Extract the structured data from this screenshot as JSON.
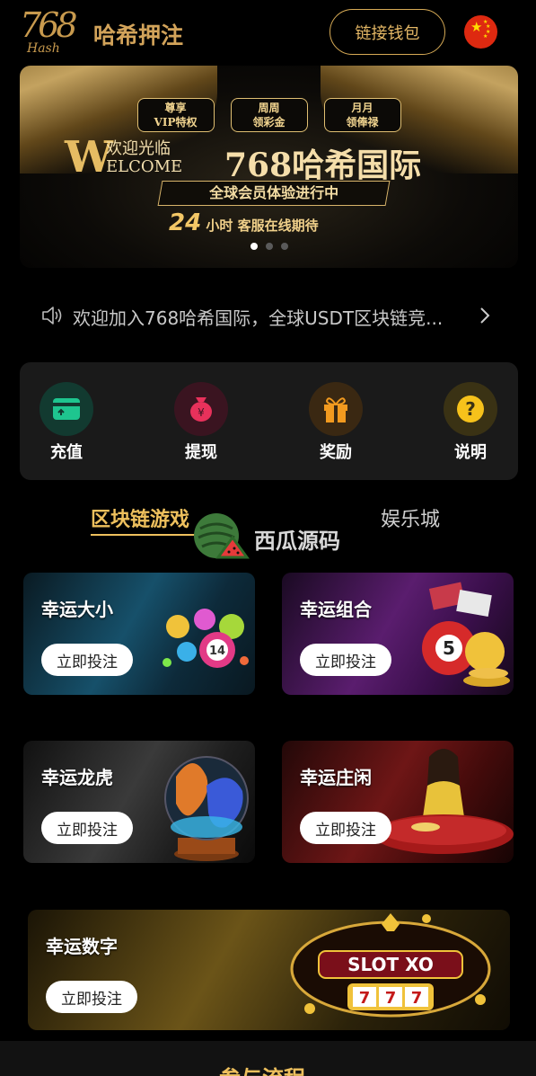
{
  "header": {
    "logo_number": "768",
    "logo_sub": "Hash",
    "brand_name": "哈希押注",
    "wallet_button": "链接钱包",
    "language_flag": "cn-flag-icon"
  },
  "banner": {
    "badges": [
      {
        "line1": "尊享",
        "line2": "VIP特权"
      },
      {
        "line1": "周周",
        "line2": "领彩金"
      },
      {
        "line1": "月月",
        "line2": "领俸禄"
      }
    ],
    "welcome_letter": "W",
    "welcome_cn": "欢迎光临",
    "welcome_en": "ELCOME",
    "welcome_title": "768哈希国际",
    "slogan": "全球会员体验进行中",
    "service_number": "24",
    "service_text": "小时 客服在线期待",
    "slide_count": 3,
    "active_slide": 1
  },
  "notice": {
    "icon": "speaker-icon",
    "text": "欢迎加入768哈希国际，全球USDT区块链竞...",
    "arrow_icon": "chevron-right-icon"
  },
  "actions": [
    {
      "label": "充值",
      "icon": "wallet-icon",
      "color": "#1ec58f"
    },
    {
      "label": "提现",
      "icon": "money-bag-icon",
      "color": "#e8315b"
    },
    {
      "label": "奖励",
      "icon": "gift-icon",
      "color": "#f29a1f"
    },
    {
      "label": "说明",
      "icon": "question-icon",
      "color": "#f6c21b"
    }
  ],
  "tabs": {
    "active": "区块链游戏",
    "inactive": "娱乐城"
  },
  "watermark": {
    "text": "西瓜源码"
  },
  "games": [
    {
      "name": "幸运大小",
      "button": "立即投注"
    },
    {
      "name": "幸运组合",
      "button": "立即投注"
    },
    {
      "name": "幸运龙虎",
      "button": "立即投注"
    },
    {
      "name": "幸运庄闲",
      "button": "立即投注"
    },
    {
      "name": "幸运数字",
      "button": "立即投注"
    }
  ],
  "bottom": {
    "title": "参与流程"
  },
  "colors": {
    "accent": "#eec05d",
    "background": "#000000",
    "panel": "#1a1a1a"
  }
}
